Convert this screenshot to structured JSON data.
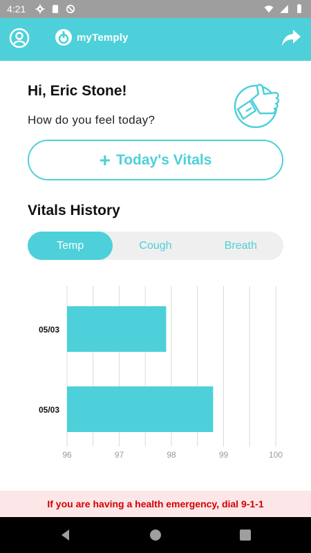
{
  "status_bar": {
    "time": "4:21",
    "left_icons": [
      "gear-icon",
      "sd-card-icon",
      "do-not-disturb-icon"
    ],
    "right_icons": [
      "wifi-icon",
      "cellular-icon",
      "battery-icon"
    ]
  },
  "header": {
    "brand_name": "myTemply",
    "accent_color": "#4dd0d9"
  },
  "greeting": {
    "hello": "Hi, Eric Stone!",
    "question": "How do you feel today?"
  },
  "vitals_button": {
    "plus": "+",
    "label": "Today's Vitals"
  },
  "history": {
    "title": "Vitals History",
    "tabs": [
      {
        "label": "Temp",
        "active": true
      },
      {
        "label": "Cough",
        "active": false
      },
      {
        "label": "Breath",
        "active": false
      }
    ]
  },
  "chart_data": {
    "type": "bar",
    "orientation": "horizontal",
    "categories": [
      "05/03",
      "05/03"
    ],
    "values": [
      97.9,
      98.8
    ],
    "xlim": [
      96,
      100
    ],
    "x_ticks": [
      "96",
      "97",
      "98",
      "99",
      "100"
    ],
    "grid": true,
    "bar_color": "#4dd0d9"
  },
  "emergency": {
    "text": "If you are having a health emergency, dial 9-1-1"
  }
}
